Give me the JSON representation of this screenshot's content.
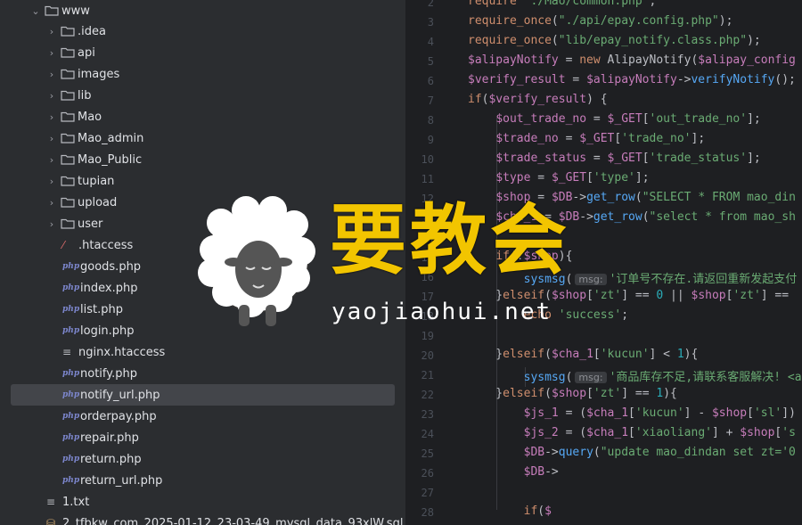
{
  "sidebar": {
    "root": "www",
    "items": [
      {
        "label": ".idea",
        "type": "folder"
      },
      {
        "label": "api",
        "type": "folder"
      },
      {
        "label": "images",
        "type": "folder"
      },
      {
        "label": "lib",
        "type": "folder"
      },
      {
        "label": "Mao",
        "type": "folder"
      },
      {
        "label": "Mao_admin",
        "type": "folder"
      },
      {
        "label": "Mao_Public",
        "type": "folder"
      },
      {
        "label": "tupian",
        "type": "folder"
      },
      {
        "label": "upload",
        "type": "folder"
      },
      {
        "label": "user",
        "type": "folder"
      },
      {
        "label": ".htaccess",
        "type": "htaccess"
      },
      {
        "label": "goods.php",
        "type": "php"
      },
      {
        "label": "index.php",
        "type": "php"
      },
      {
        "label": "list.php",
        "type": "php"
      },
      {
        "label": "login.php",
        "type": "php"
      },
      {
        "label": "nginx.htaccess",
        "type": "text"
      },
      {
        "label": "notify.php",
        "type": "php"
      },
      {
        "label": "notify_url.php",
        "type": "php",
        "selected": true
      },
      {
        "label": "orderpay.php",
        "type": "php"
      },
      {
        "label": "repair.php",
        "type": "php"
      },
      {
        "label": "return.php",
        "type": "php"
      },
      {
        "label": "return_url.php",
        "type": "php"
      }
    ],
    "bottom_items": [
      {
        "label": "1.txt",
        "type": "text"
      },
      {
        "label": "2_tfbkw_com_2025-01-12_23-03-49_mysql_data_93xlW.sql",
        "type": "sql"
      }
    ]
  },
  "editor": {
    "line_numbers": [
      "2",
      "3",
      "4",
      "5",
      "6",
      "7",
      "8",
      "9",
      "10",
      "11",
      "12",
      "13",
      "14",
      "15",
      "16",
      "17",
      "18",
      "19",
      "20",
      "21",
      "22",
      "23",
      "24",
      "25",
      "26",
      "27",
      "28"
    ],
    "hints": {
      "msg": "msg:"
    },
    "strings": {
      "l2": "'./Mao/common.php'",
      "l3": "\"./api/epay.config.php\"",
      "l4": "\"lib/epay_notify.class.php\"",
      "l9": "'out_trade_no'",
      "l10": "'trade_no'",
      "l11": "'trade_status'",
      "l12": "'type'",
      "l13": "\"SELECT * FROM mao_din",
      "l14": "\"select * from mao_sh",
      "l16": "'订单号不存在.请返回重新发起支付",
      "l17a": "'zt'",
      "l17b": "'zt'",
      "l18": "'success'",
      "l20": "'kucun'",
      "l21": "'商品库存不足,请联系客服解决! <a",
      "l22": "'zt'",
      "l23a": "'kucun'",
      "l23b": "'sl'",
      "l24a": "'xiaoliang'",
      "l24b": "'s",
      "l25": "\"update mao_dindan set zt='0"
    },
    "numbers": {
      "zero": "0",
      "one": "1"
    }
  },
  "watermark": {
    "cn": "要教会",
    "en": "yaojiaohui.net"
  }
}
